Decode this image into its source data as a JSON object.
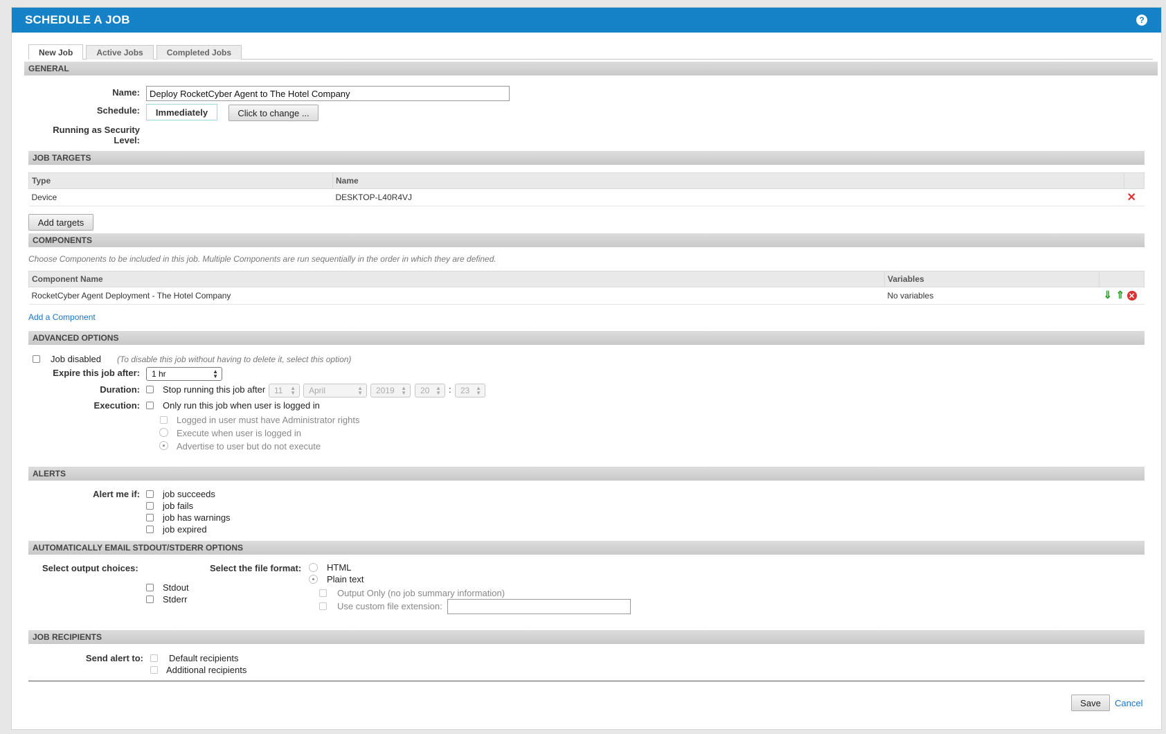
{
  "window": {
    "title": "SCHEDULE A JOB"
  },
  "tabs": [
    {
      "label": "New Job",
      "active": true
    },
    {
      "label": "Active Jobs",
      "active": false
    },
    {
      "label": "Completed Jobs",
      "active": false
    }
  ],
  "general": {
    "heading": "GENERAL",
    "name_label": "Name:",
    "name_value": "Deploy RocketCyber Agent to The Hotel Company",
    "schedule_label": "Schedule:",
    "schedule_value": "Immediately",
    "change_button": "Click to change ...",
    "security_label_line1": "Running as Security",
    "security_label_line2": "Level:"
  },
  "job_targets": {
    "heading": "JOB TARGETS",
    "columns": [
      "Type",
      "Name"
    ],
    "rows": [
      {
        "type": "Device",
        "name": "DESKTOP-L40R4VJ"
      }
    ],
    "add_button": "Add targets"
  },
  "components": {
    "heading": "COMPONENTS",
    "description": "Choose Components to be included in this job. Multiple Components are run sequentially in the order in which they are defined.",
    "columns": [
      "Component Name",
      "Variables"
    ],
    "rows": [
      {
        "name": "RocketCyber Agent Deployment - The Hotel Company",
        "variables": "No variables"
      }
    ],
    "add_link": "Add a Component"
  },
  "advanced": {
    "heading": "ADVANCED OPTIONS",
    "job_disabled_label": "Job disabled",
    "job_disabled_hint": "(To disable this job without having to delete it, select this option)",
    "expire_label": "Expire this job after:",
    "expire_value": "1 hr",
    "duration_label": "Duration:",
    "duration_text": "Stop running this job after",
    "day": "11",
    "month": "April",
    "year": "2019",
    "hour": "20",
    "colon": ":",
    "minute": "23",
    "execution_label": "Execution:",
    "execution_text": "Only run this job when user is logged in",
    "exec_admin": "Logged in user must have Administrator rights",
    "exec_when_logged": "Execute when user is logged in",
    "exec_advertise": "Advertise to user but do not execute"
  },
  "alerts": {
    "heading": "ALERTS",
    "label": "Alert me if:",
    "options": [
      "job succeeds",
      "job fails",
      "job has warnings",
      "job expired"
    ]
  },
  "email": {
    "heading": "AUTOMATICALLY EMAIL STDOUT/STDERR OPTIONS",
    "output_label": "Select output choices:",
    "format_label": "Select the file format:",
    "format_html": "HTML",
    "format_plain": "Plain text",
    "stdout": "Stdout",
    "stderr": "Stderr",
    "output_only": "Output Only (no job summary information)",
    "custom_ext": "Use custom file extension:"
  },
  "recipients": {
    "heading": "JOB RECIPIENTS",
    "label": "Send alert to:",
    "default": "Default recipients",
    "additional": "Additional recipients"
  },
  "footer": {
    "save": "Save",
    "cancel": "Cancel"
  },
  "colors": {
    "title_bar": "#1581c6",
    "link": "#1a73c5",
    "delete": "#d9322f",
    "move": "#2f9a2b"
  }
}
